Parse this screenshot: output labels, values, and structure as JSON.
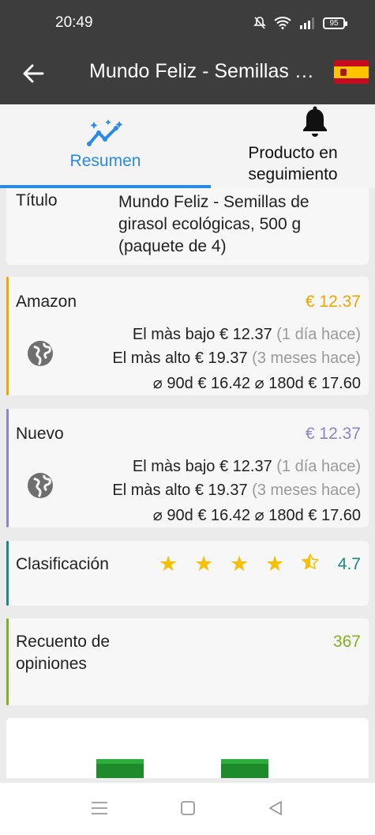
{
  "status": {
    "time": "20:49",
    "battery": "95"
  },
  "appbar": {
    "title": "Mundo Feliz - Semillas de girasol ecológicas, 500 g (paquete de 4)",
    "flag": "spain-flag"
  },
  "tabs": [
    {
      "label": "Resumen",
      "icon": "chart-sparkle-icon",
      "active": true
    },
    {
      "label": "Producto en seguimiento",
      "icon": "bell-icon",
      "active": false
    }
  ],
  "title_card": {
    "key": "Título",
    "value": "Mundo Feliz - Semillas de girasol ecológicas, 500 g (paquete de 4)"
  },
  "amazon": {
    "name": "Amazon",
    "price": "€ 12.37",
    "color": "#f0a500",
    "lowest_label": "El màs bajo",
    "lowest_price": "€ 12.37",
    "lowest_when": "(1 día hace)",
    "highest_label": "El màs alto",
    "highest_price": "€ 19.37",
    "highest_when": "(3 meses hace)",
    "avg90_label": "⌀ 90d",
    "avg90_price": "€ 16.42",
    "avg180_label": "⌀ 180d",
    "avg180_price": "€ 17.60"
  },
  "nuevo": {
    "name": "Nuevo",
    "price": "€ 12.37",
    "color": "#8a86c9",
    "lowest_label": "El màs bajo",
    "lowest_price": "€ 12.37",
    "lowest_when": "(1 día hace)",
    "highest_label": "El màs alto",
    "highest_price": "€ 19.37",
    "highest_when": "(3 meses hace)",
    "avg90_label": "⌀ 90d",
    "avg90_price": "€ 16.42",
    "avg180_label": "⌀ 180d",
    "avg180_price": "€ 17.60"
  },
  "rating": {
    "name": "Clasificación",
    "value": "4.7",
    "stars": 4.5,
    "color": "#188a85"
  },
  "reviews": {
    "name": "Recuento de opiniones",
    "value": "367",
    "color": "#82b020"
  }
}
